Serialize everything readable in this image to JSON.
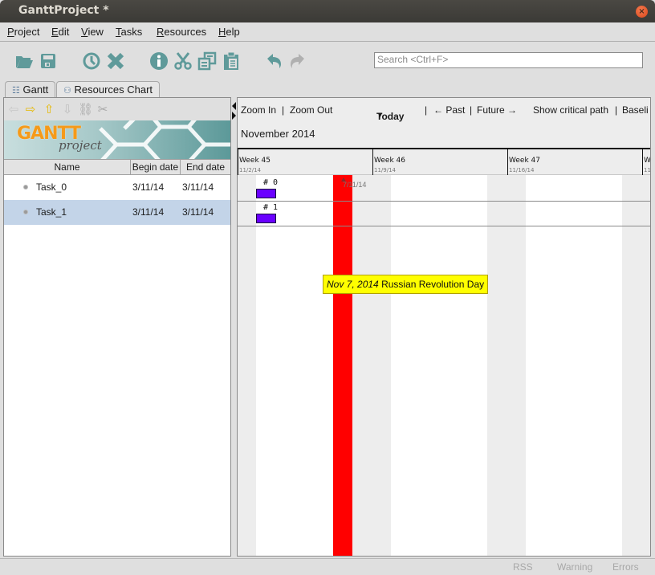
{
  "window": {
    "title": "GanttProject *",
    "close_icon": "close-icon"
  },
  "menu": {
    "items": [
      {
        "label": "Project",
        "mnemonic": "P",
        "rest": "roject"
      },
      {
        "label": "Edit",
        "mnemonic": "E",
        "rest": "dit"
      },
      {
        "label": "View",
        "mnemonic": "V",
        "rest": "iew"
      },
      {
        "label": "Tasks",
        "mnemonic": "T",
        "rest": "asks"
      },
      {
        "label": "Resources",
        "mnemonic": "R",
        "rest": "esources"
      },
      {
        "label": "Help",
        "mnemonic": "H",
        "rest": "elp"
      }
    ]
  },
  "toolbar": {
    "buttons": [
      {
        "name": "open",
        "icon": "folder-open-icon"
      },
      {
        "name": "save",
        "icon": "floppy-disk-icon"
      },
      {
        "name": "new-task",
        "icon": "clock-icon"
      },
      {
        "name": "delete",
        "icon": "x-delete-icon"
      },
      {
        "name": "properties",
        "icon": "info-icon"
      },
      {
        "name": "cut",
        "icon": "scissors-icon"
      },
      {
        "name": "copy",
        "icon": "copy-icon"
      },
      {
        "name": "paste",
        "icon": "clipboard-icon"
      },
      {
        "name": "undo",
        "icon": "undo-icon"
      },
      {
        "name": "redo",
        "icon": "redo-icon"
      }
    ],
    "search_placeholder": "Search <Ctrl+F>",
    "icon_color": "#5f9a9a",
    "disabled_color": "#b0b0b0"
  },
  "tabs": [
    {
      "label": "Gantt",
      "icon": "tree-list-icon",
      "active": true
    },
    {
      "label": "Resources Chart",
      "icon": "people-icon",
      "active": false
    }
  ],
  "task_nav": {
    "buttons": [
      {
        "name": "unindent",
        "icon": "arrow-left-icon",
        "enabled": false
      },
      {
        "name": "indent",
        "icon": "arrow-right-icon",
        "enabled": true
      },
      {
        "name": "move-up",
        "icon": "arrow-up-icon",
        "enabled": true
      },
      {
        "name": "move-down",
        "icon": "arrow-down-icon",
        "enabled": false
      },
      {
        "name": "link",
        "icon": "link-icon",
        "enabled": false
      },
      {
        "name": "unlink",
        "icon": "unlink-icon",
        "enabled": false
      }
    ]
  },
  "logo": {
    "brand": "GANTT",
    "sub": "project"
  },
  "task_table": {
    "columns": [
      "Name",
      "Begin date",
      "End date"
    ],
    "rows": [
      {
        "name": "Task_0",
        "begin": "3/11/14",
        "end": "3/11/14",
        "selected": false
      },
      {
        "name": "Task_1",
        "begin": "3/11/14",
        "end": "3/11/14",
        "selected": true
      }
    ]
  },
  "chart_toolbar": {
    "zoom_in": "Zoom In",
    "sep1": "|",
    "zoom_out": "Zoom Out",
    "today": "Today",
    "sep2": "|",
    "past": "← Past",
    "sep3": "|",
    "future": "Future →",
    "critical_path": "Show critical path",
    "sep4": "|",
    "baseline": "Baseli"
  },
  "timeline": {
    "month": "November 2014",
    "weeks": [
      {
        "label": "Week 45",
        "date": "11/2/14"
      },
      {
        "label": "Week 46",
        "date": "11/9/14"
      },
      {
        "label": "Week 47",
        "date": "11/16/14"
      },
      {
        "label": "W",
        "date": "11/"
      }
    ]
  },
  "gantt": {
    "tasks": [
      {
        "label": "# 0",
        "bar_color": "#6a00ff"
      },
      {
        "label": "# 1",
        "bar_color": "#6a00ff"
      }
    ],
    "marker_text": "7/11/14",
    "holiday_color": "#ff0000",
    "tooltip": {
      "date": "Nov 7, 2014",
      "text": "Russian Revolution Day"
    }
  },
  "statusbar": {
    "rss": "RSS",
    "warning": "Warning",
    "errors": "Errors"
  }
}
